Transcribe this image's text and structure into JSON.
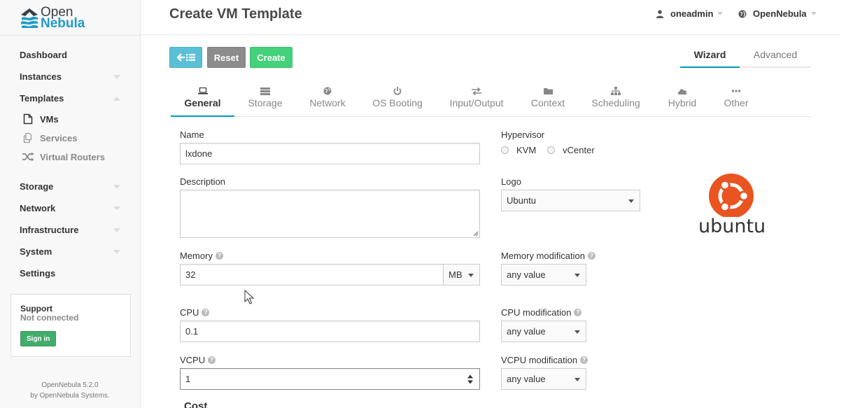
{
  "brand": {
    "line1": "Open",
    "line2": "Nebula"
  },
  "sidebar": {
    "items": [
      {
        "label": "Dashboard"
      },
      {
        "label": "Instances"
      },
      {
        "label": "Templates"
      },
      {
        "label": "Storage"
      },
      {
        "label": "Network"
      },
      {
        "label": "Infrastructure"
      },
      {
        "label": "System"
      },
      {
        "label": "Settings"
      }
    ],
    "templates_sub": [
      {
        "label": "VMs",
        "icon": "file-icon"
      },
      {
        "label": "Services",
        "icon": "services-icon"
      },
      {
        "label": "Virtual Routers",
        "icon": "shuffle-icon"
      }
    ],
    "support": {
      "title": "Support",
      "status": "Not connected",
      "signin_label": "Sign in"
    },
    "version": {
      "line1": "OpenNebula 5.2.0",
      "line2": "by OpenNebula Systems."
    }
  },
  "header": {
    "title": "Create VM Template",
    "user": "oneadmin",
    "zone": "OpenNebula"
  },
  "toolbar": {
    "reset_label": "Reset",
    "create_label": "Create"
  },
  "mode_tabs": {
    "wizard": "Wizard",
    "advanced": "Advanced"
  },
  "section_tabs": [
    {
      "label": "General",
      "icon": "laptop-icon"
    },
    {
      "label": "Storage",
      "icon": "storage-icon"
    },
    {
      "label": "Network",
      "icon": "globe-icon"
    },
    {
      "label": "OS Booting",
      "icon": "power-icon"
    },
    {
      "label": "Input/Output",
      "icon": "exchange-icon"
    },
    {
      "label": "Context",
      "icon": "folder-icon"
    },
    {
      "label": "Scheduling",
      "icon": "sitemap-icon"
    },
    {
      "label": "Hybrid",
      "icon": "cloud-icon"
    },
    {
      "label": "Other",
      "icon": "ellipsis-icon"
    }
  ],
  "form": {
    "name": {
      "label": "Name",
      "value": "lxdone"
    },
    "description": {
      "label": "Description",
      "value": ""
    },
    "memory": {
      "label": "Memory",
      "value": "32",
      "unit": "MB"
    },
    "cpu": {
      "label": "CPU",
      "value": "0.1"
    },
    "vcpu": {
      "label": "VCPU",
      "value": "1"
    },
    "hypervisor": {
      "label": "Hypervisor",
      "options": [
        "KVM",
        "vCenter"
      ]
    },
    "logo": {
      "label": "Logo",
      "value": "Ubuntu"
    },
    "memory_mod": {
      "label": "Memory modification",
      "value": "any value"
    },
    "cpu_mod": {
      "label": "CPU modification",
      "value": "any value"
    },
    "vcpu_mod": {
      "label": "VCPU modification",
      "value": "any value"
    },
    "cost": {
      "label": "Cost"
    }
  },
  "logo_image": {
    "word": "ubuntu",
    "color": "#e95420"
  },
  "colors": {
    "accent": "#0098c3",
    "back_button": "#5bbfd8",
    "reset_button": "#8c8c8c",
    "create_button": "#43d17a"
  }
}
